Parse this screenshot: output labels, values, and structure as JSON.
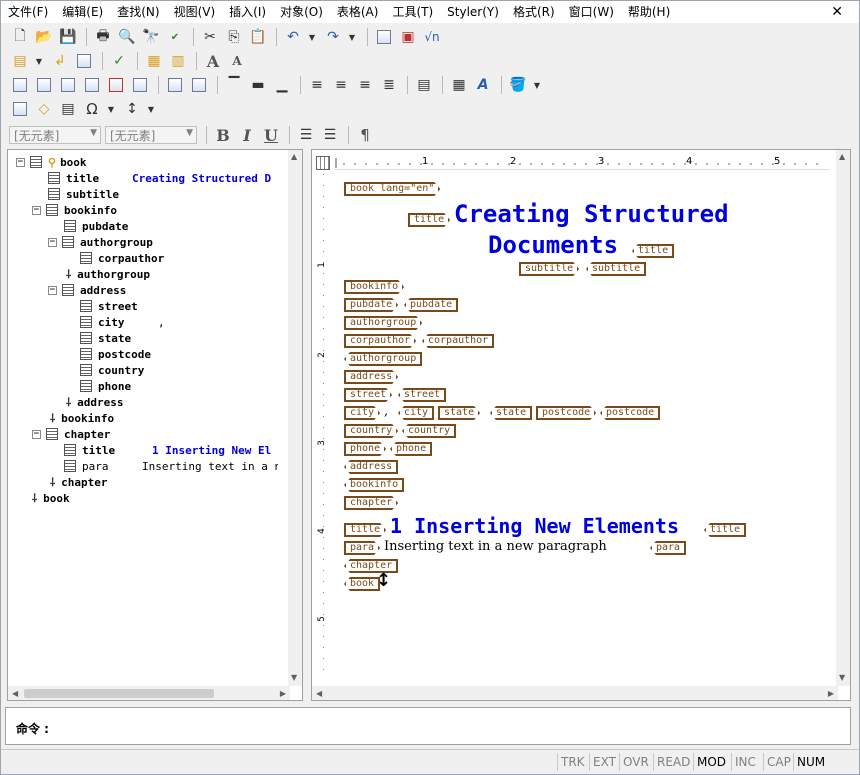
{
  "menu": [
    "文件(F)",
    "编辑(E)",
    "查找(N)",
    "视图(V)",
    "插入(I)",
    "对象(O)",
    "表格(A)",
    "工具(T)",
    "Styler(Y)",
    "格式(R)",
    "窗口(W)",
    "帮助(H)"
  ],
  "window": {
    "close": "✕"
  },
  "toolbar": {
    "element_select1": "[无元素]",
    "element_select2": "[无元素]",
    "bold": "B",
    "italic": "I",
    "underline": "U",
    "pilcrow": "¶",
    "font_up": "A",
    "font_down": "A",
    "omega": "Ω",
    "sqrt": "√n"
  },
  "tree": [
    {
      "label": "book",
      "content": ""
    },
    {
      "label": "title",
      "content": "Creating Structured D"
    },
    {
      "label": "subtitle",
      "content": ""
    },
    {
      "label": "bookinfo",
      "content": ""
    },
    {
      "label": "pubdate",
      "content": ""
    },
    {
      "label": "authorgroup",
      "content": ""
    },
    {
      "label": "corpauthor",
      "content": ""
    },
    {
      "label": "authorgroup",
      "content": ""
    },
    {
      "label": "address",
      "content": ""
    },
    {
      "label": "street",
      "content": ""
    },
    {
      "label": "city",
      "content": ","
    },
    {
      "label": "state",
      "content": ""
    },
    {
      "label": "postcode",
      "content": ""
    },
    {
      "label": "country",
      "content": ""
    },
    {
      "label": "phone",
      "content": ""
    },
    {
      "label": "address",
      "content": ""
    },
    {
      "label": "bookinfo",
      "content": ""
    },
    {
      "label": "chapter",
      "content": ""
    },
    {
      "label": "title",
      "content": "1 Inserting New El"
    },
    {
      "label": "para",
      "content": "Inserting text in a new"
    },
    {
      "label": "chapter",
      "content": ""
    },
    {
      "label": "book",
      "content": ""
    }
  ],
  "ruler": {
    "marks": [
      "1",
      "2",
      "3",
      "4",
      "5"
    ],
    "vmarks": [
      "1",
      "2",
      "3",
      "4",
      "5"
    ]
  },
  "doc": {
    "book_tag": "book lang=\"en\"",
    "title_tag": "title",
    "title_line1": "Creating Structured",
    "title_line2": "Documents",
    "subtitle_tag": "subtitle",
    "bookinfo_tag": "bookinfo",
    "pubdate_tag": "pubdate",
    "authorgroup_tag": "authorgroup",
    "corpauthor_tag": "corpauthor",
    "address_tag": "address",
    "street_tag": "street",
    "city_tag": "city",
    "city_text": ",",
    "state_tag": "state",
    "postcode_tag": "postcode",
    "country_tag": "country",
    "phone_tag": "phone",
    "chapter_tag": "chapter",
    "chapter_title": "1 Inserting New Elements",
    "para_tag": "para",
    "para_text": "Inserting text in a new paragraph",
    "book_end": "book"
  },
  "command": {
    "label": "命令 :"
  },
  "status": [
    "TRK",
    "EXT",
    "OVR",
    "READ",
    "MOD",
    "INC",
    "CAP",
    "NUM"
  ],
  "status_on": [
    "MOD",
    "NUM"
  ]
}
